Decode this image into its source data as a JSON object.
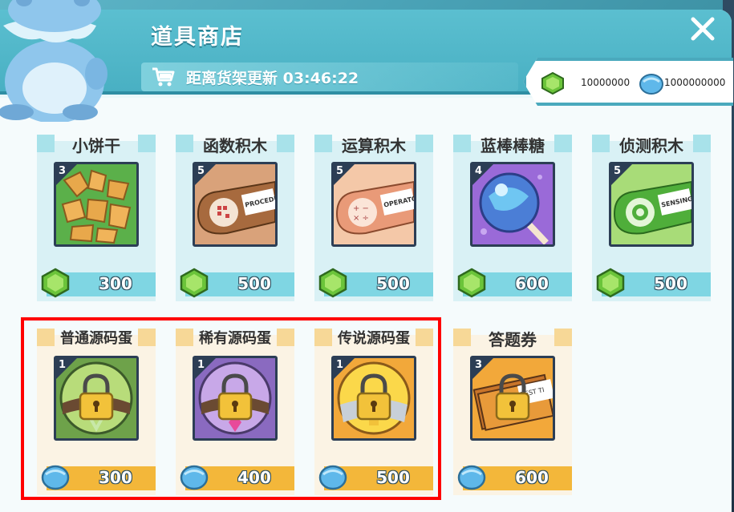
{
  "shop": {
    "title": "道具商店",
    "refresh_label": "距离货架更新 03:46:22"
  },
  "currency": {
    "gems": "10000000",
    "orbs": "1000000000"
  },
  "items_row1": [
    {
      "name": "小饼干",
      "level": "3",
      "price": "300"
    },
    {
      "name": "函数积木",
      "level": "5",
      "price": "500"
    },
    {
      "name": "运算积木",
      "level": "5",
      "price": "500"
    },
    {
      "name": "蓝棒棒糖",
      "level": "4",
      "price": "600"
    },
    {
      "name": "侦测积木",
      "level": "5",
      "price": "500"
    }
  ],
  "items_row2": [
    {
      "name": "普通源码蛋",
      "level": "1",
      "price": "300"
    },
    {
      "name": "稀有源码蛋",
      "level": "1",
      "price": "400"
    },
    {
      "name": "传说源码蛋",
      "level": "1",
      "price": "500"
    },
    {
      "name": "答题券",
      "level": "3",
      "price": "600"
    }
  ],
  "thumb_text": {
    "procedure": "PROCEDU",
    "operator": "OPERATO",
    "sensing": "SENSING",
    "ticket": "TEST TI"
  },
  "colors": {
    "panel": "#eaf8fa",
    "header": "#49b0c3",
    "teal_bar": "#7fd6e3",
    "orange_bar": "#f3b73a",
    "highlight": "#ff0000"
  }
}
